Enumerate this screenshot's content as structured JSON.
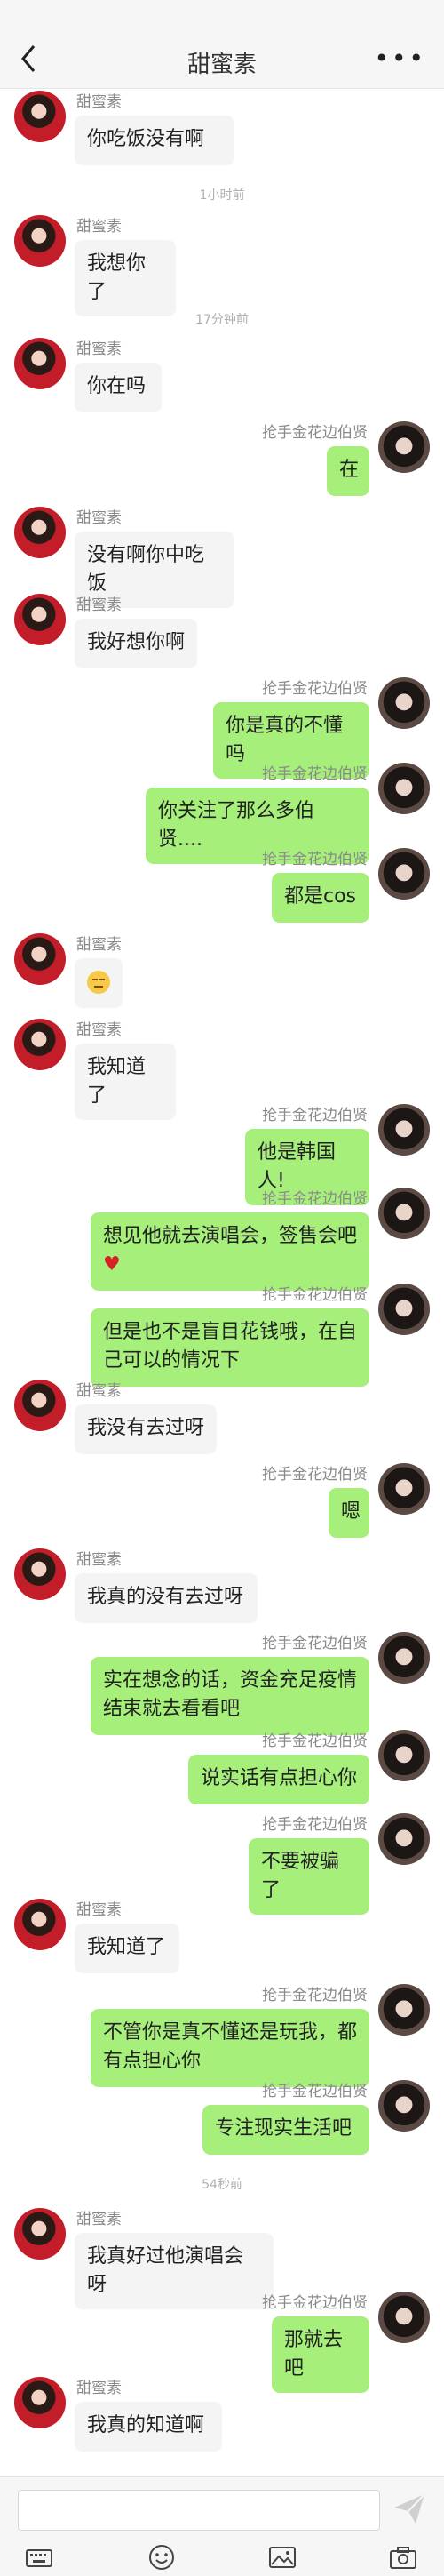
{
  "header": {
    "title": "甜蜜素",
    "more_label": "•••"
  },
  "input": {
    "value": ""
  },
  "timestamps": {
    "t1": "1小时前",
    "t2": "17分钟前",
    "t3": "54秒前"
  },
  "messages": [
    {
      "side": "left",
      "sender": "甜蜜素",
      "text": "你吃饭没有啊"
    },
    {
      "side": "left",
      "sender": "甜蜜素",
      "text": "我想你了"
    },
    {
      "side": "left",
      "sender": "甜蜜素",
      "text": "你在吗"
    },
    {
      "side": "right",
      "sender": "抢手金花边伯贤",
      "text": "在"
    },
    {
      "side": "left",
      "sender": "甜蜜素",
      "text": "没有啊你中吃饭"
    },
    {
      "side": "left",
      "sender": "甜蜜素",
      "text": "我好想你啊"
    },
    {
      "side": "right",
      "sender": "抢手金花边伯贤",
      "text": "你是真的不懂吗"
    },
    {
      "side": "right",
      "sender": "抢手金花边伯贤",
      "text": "你关注了那么多伯贤...."
    },
    {
      "side": "right",
      "sender": "抢手金花边伯贤",
      "text": "都是cos"
    },
    {
      "side": "left",
      "sender": "甜蜜素",
      "text": "",
      "emoji": "unamused-face-emoji"
    },
    {
      "side": "left",
      "sender": "甜蜜素",
      "text": "我知道了"
    },
    {
      "side": "right",
      "sender": "抢手金花边伯贤",
      "text": "他是韩国人!"
    },
    {
      "side": "right",
      "sender": "抢手金花边伯贤",
      "text": "想见他就去演唱会，签售会吧",
      "heart": "♥"
    },
    {
      "side": "right",
      "sender": "抢手金花边伯贤",
      "text": "但是也不是盲目花钱哦，在自己可以的情况下"
    },
    {
      "side": "left",
      "sender": "甜蜜素",
      "text": "我没有去过呀"
    },
    {
      "side": "right",
      "sender": "抢手金花边伯贤",
      "text": "嗯"
    },
    {
      "side": "left",
      "sender": "甜蜜素",
      "text": "我真的没有去过呀"
    },
    {
      "side": "right",
      "sender": "抢手金花边伯贤",
      "text": "实在想念的话，资金充足疫情结束就去看看吧"
    },
    {
      "side": "right",
      "sender": "抢手金花边伯贤",
      "text": "说实话有点担心你"
    },
    {
      "side": "right",
      "sender": "抢手金花边伯贤",
      "text": "不要被骗了"
    },
    {
      "side": "left",
      "sender": "甜蜜素",
      "text": "我知道了"
    },
    {
      "side": "right",
      "sender": "抢手金花边伯贤",
      "text": "不管你是真不懂还是玩我，都有点担心你"
    },
    {
      "side": "right",
      "sender": "抢手金花边伯贤",
      "text": "专注现实生活吧"
    },
    {
      "side": "left",
      "sender": "甜蜜素",
      "text": "我真好过他演唱会呀"
    },
    {
      "side": "right",
      "sender": "抢手金花边伯贤",
      "text": "那就去吧"
    },
    {
      "side": "left",
      "sender": "甜蜜素",
      "text": "我真的知道啊"
    }
  ],
  "toolbar": [
    "keyboard-icon",
    "emoji-icon",
    "image-icon",
    "camera-icon"
  ]
}
